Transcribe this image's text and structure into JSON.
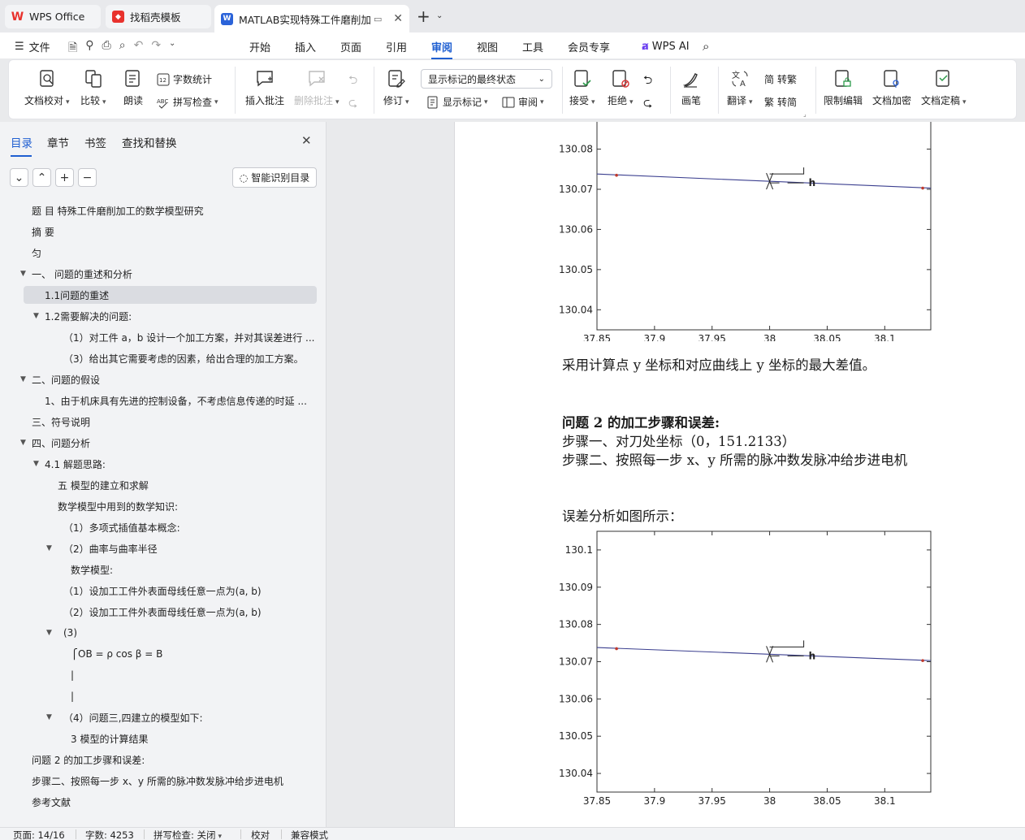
{
  "tabs": [
    {
      "label": "WPS Office",
      "icon": "wps-logo-icon",
      "color": "#e8322d"
    },
    {
      "label": "找稻壳模板",
      "icon": "docer-icon",
      "color": "#e8322d"
    },
    {
      "label": "MATLAB实现特殊工件磨削加",
      "icon": "word-doc-icon",
      "color": "#2b63d9"
    }
  ],
  "menu": {
    "file": "文件",
    "items": [
      "开始",
      "插入",
      "页面",
      "引用",
      "审阅",
      "视图",
      "工具",
      "会员专享"
    ],
    "active": "审阅",
    "wps_ai": "WPS AI"
  },
  "ribbon": {
    "proofread": "文档校对",
    "compare": "比较",
    "read_aloud": "朗读",
    "word_count": "字数统计",
    "spell_check": "拼写检查",
    "insert_comment": "插入批注",
    "delete_comment": "删除批注",
    "revise": "修订",
    "markup_state": "显示标记的最终状态",
    "show_markup": "显示标记",
    "review_pane": "审阅",
    "accept": "接受",
    "reject": "拒绝",
    "pen": "画笔",
    "translate": "翻译",
    "to_traditional": "转繁",
    "to_simplified": "转简",
    "restrict_edit": "限制编辑",
    "encrypt": "文档加密",
    "finalize": "文档定稿"
  },
  "nav": {
    "tabs": [
      "目录",
      "章节",
      "书签",
      "查找和替换"
    ],
    "ai_toc": "智能识别目录",
    "toc": [
      {
        "text": "题 目  特殊工件磨削加工的数学模型研究",
        "level": 0
      },
      {
        "text": "摘 要",
        "level": 0
      },
      {
        "text": "匀",
        "level": 0
      },
      {
        "text": "一、 问题的重述和分析",
        "level": 0,
        "caret": true
      },
      {
        "text": "1.1问题的重述",
        "level": 1,
        "selected": true
      },
      {
        "text": "1.2需要解决的问题:",
        "level": 1,
        "caret": true
      },
      {
        "text": "（1）对工件 a，b 设计一个加工方案，并对其误差进行 ...",
        "level": 2
      },
      {
        "text": "（3）给出其它需要考虑的因素，给出合理的加工方案。",
        "level": 2
      },
      {
        "text": "二、问题的假设",
        "level": 0,
        "caret": true
      },
      {
        "text": "1、由于机床具有先进的控制设备，不考虑信息传递的时延 ...",
        "level": 1
      },
      {
        "text": "三、符号说明",
        "level": 0
      },
      {
        "text": "四、问题分析",
        "level": 0,
        "caret": true
      },
      {
        "text": "4.1 解题思路:",
        "level": 1,
        "caret": true
      },
      {
        "text": "五 模型的建立和求解",
        "level": 2
      },
      {
        "text": "数学模型中用到的数学知识:",
        "level": 2
      },
      {
        "text": "（1）多项式插值基本概念:",
        "level": 2
      },
      {
        "text": "（2）曲率与曲率半径",
        "level": 2,
        "caret": true
      },
      {
        "text": "数学模型:",
        "level": 3
      },
      {
        "text": "（1）设加工工件外表面母线任意一点为(a, b)",
        "level": 2
      },
      {
        "text": "（2）设加工工件外表面母线任意一点为(a, b)",
        "level": 2
      },
      {
        "text": "(3)",
        "level": 2,
        "caret": true
      },
      {
        "text": "⎧OB = ρ cos β = B",
        "level": 3
      },
      {
        "text": "|",
        "level": 3
      },
      {
        "text": "|",
        "level": 3
      },
      {
        "text": "（4）问题三,四建立的模型如下:",
        "level": 2,
        "caret": true
      },
      {
        "text": "3 模型的计算结果",
        "level": 3
      },
      {
        "text": "问题 2 的加工步骤和误差:",
        "level": 0
      },
      {
        "text": "步骤二、按照每一步 x、y 所需的脉冲数发脉冲给步进电机",
        "level": 0
      },
      {
        "text": "参考文献",
        "level": 0
      }
    ]
  },
  "doc": {
    "para1": "采用计算点  y 坐标和对应曲线上  y 坐标的最大差值。",
    "heading2": "问题 2 的加工步骤和误差:",
    "step1": "步骤一、对刀处坐标（0，151.2133）",
    "step2": "步骤二、按照每一步  x、y 所需的脉冲数发脉冲给步进电机",
    "error_caption": "误差分析如图所示："
  },
  "chart_data": [
    {
      "type": "line",
      "x_ticks": [
        "37.85",
        "37.9",
        "37.95",
        "38",
        "38.05",
        "38.1"
      ],
      "y_ticks": [
        "130.04",
        "130.05",
        "130.06",
        "130.07",
        "130.08"
      ],
      "xlim": [
        37.85,
        38.14
      ],
      "ylim": [
        130.035,
        130.105
      ],
      "annotation": "h",
      "series": [
        {
          "x": [
            37.85,
            38.14
          ],
          "y": [
            130.0738,
            130.0703
          ]
        }
      ],
      "points": [
        [
          37.867,
          130.0735
        ],
        [
          38.0,
          130.072
        ],
        [
          38.133,
          130.0703
        ]
      ]
    },
    {
      "type": "line",
      "x_ticks": [
        "37.85",
        "37.9",
        "37.95",
        "38",
        "38.05",
        "38.1"
      ],
      "y_ticks": [
        "130.04",
        "130.05",
        "130.06",
        "130.07",
        "130.08",
        "130.09",
        "130.1"
      ],
      "xlim": [
        37.85,
        38.14
      ],
      "ylim": [
        130.035,
        130.105
      ],
      "annotation": "h",
      "series": [
        {
          "x": [
            37.85,
            38.14
          ],
          "y": [
            130.0738,
            130.0703
          ]
        }
      ],
      "points": [
        [
          37.867,
          130.0735
        ],
        [
          38.0,
          130.072
        ],
        [
          38.133,
          130.0703
        ]
      ]
    }
  ],
  "status": {
    "page": "页面: 14/16",
    "words": "字数: 4253",
    "spell": "拼写检查: 关闭",
    "proof": "校对",
    "compat": "兼容模式"
  }
}
